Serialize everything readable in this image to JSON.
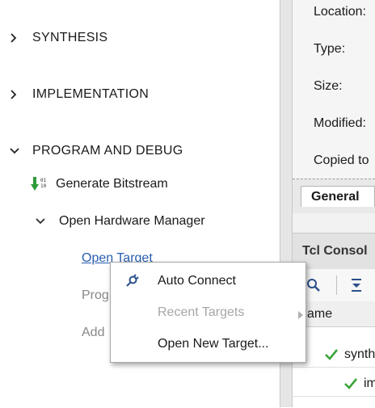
{
  "flow": {
    "synthesis": "SYNTHESIS",
    "implementation": "IMPLEMENTATION",
    "program_debug": "PROGRAM AND DEBUG",
    "generate_bitstream": "Generate Bitstream",
    "open_hardware_manager": "Open Hardware Manager",
    "open_target": "Open Target",
    "program_device_partial": "Prog",
    "add_config_partial": "Add"
  },
  "properties": {
    "location": "Location:",
    "type": "Type:",
    "size": "Size:",
    "modified": "Modified:",
    "copied_to": "Copied to"
  },
  "tabs": {
    "general": "General"
  },
  "tcl": {
    "title": "Tcl Consol",
    "column_name": "ame",
    "rows": [
      "synth",
      "im"
    ]
  },
  "context_menu": {
    "auto_connect": "Auto Connect",
    "recent_targets": "Recent Targets",
    "open_new_target": "Open New Target..."
  },
  "colors": {
    "link": "#2a5db0",
    "check_green": "#3aa43a",
    "bitstream_green": "#2e9a3a",
    "disabled": "#a6a6a6"
  }
}
